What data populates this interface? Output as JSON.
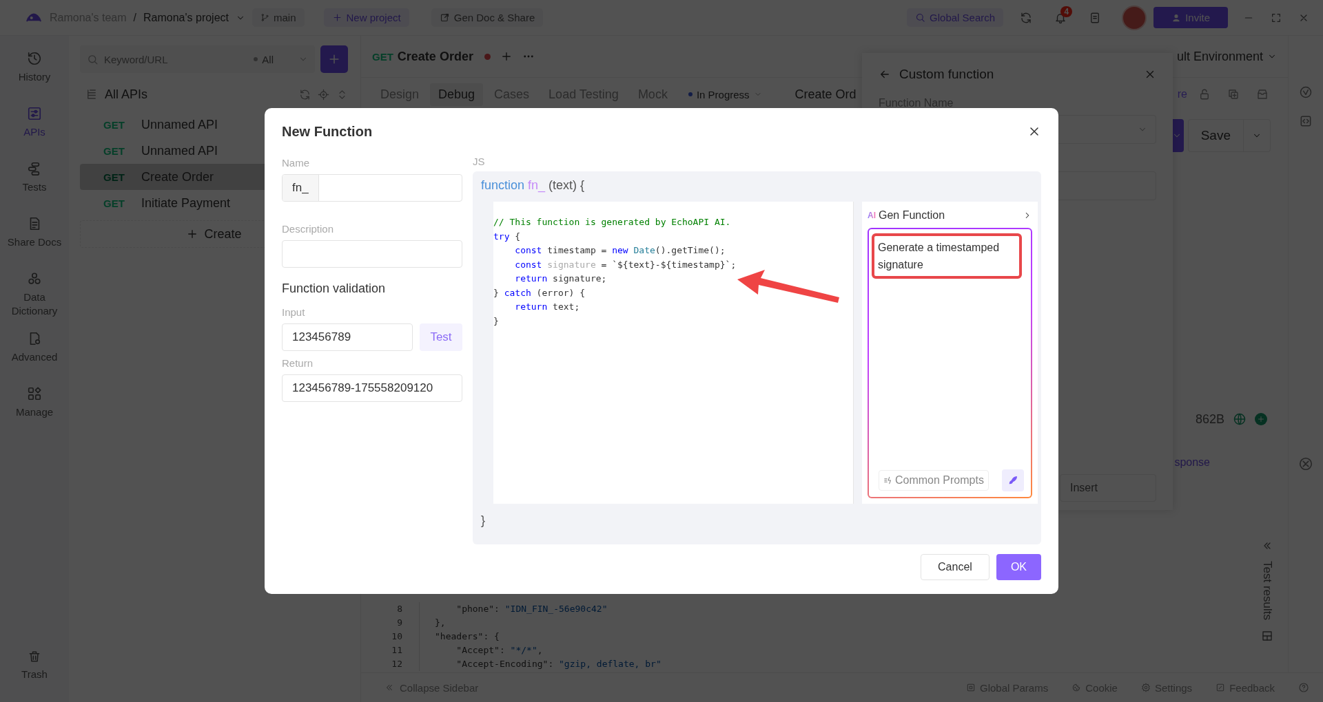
{
  "top_bar": {
    "team": "Ramona's team",
    "separator": "/",
    "project": "Ramona's project",
    "branch": "main",
    "new_project": "New project",
    "gen_doc": "Gen Doc & Share",
    "global_search": "Global Search",
    "notification_count": "4",
    "invite": "Invite"
  },
  "nav": [
    {
      "label": "History",
      "selected": false
    },
    {
      "label": "APIs",
      "selected": true
    },
    {
      "label": "Tests",
      "selected": false
    },
    {
      "label": "Share Docs",
      "selected": false
    },
    {
      "label": "Data Dictionary",
      "selected": false
    },
    {
      "label": "Advanced",
      "selected": false
    },
    {
      "label": "Manage",
      "selected": false
    }
  ],
  "nav_bottom": {
    "label": "Trash"
  },
  "api_panel": {
    "search_placeholder": "Keyword/URL",
    "filter": "All",
    "tree_title": "All APIs",
    "items": [
      {
        "method": "GET",
        "name": "Unnamed API",
        "selected": false
      },
      {
        "method": "GET",
        "name": "Unnamed API",
        "selected": false
      },
      {
        "method": "GET",
        "name": "Create Order",
        "selected": true
      },
      {
        "method": "GET",
        "name": "Initiate Payment",
        "selected": false
      }
    ],
    "create": "Create"
  },
  "request_tab": {
    "method": "GET",
    "name": "Create Order",
    "modified": true
  },
  "environment": "ult Environment",
  "subtabs": [
    {
      "label": "Design",
      "selected": false
    },
    {
      "label": "Debug",
      "selected": true
    },
    {
      "label": "Cases",
      "selected": false
    },
    {
      "label": "Load Testing",
      "selected": false
    },
    {
      "label": "Mock",
      "selected": false
    }
  ],
  "status": "In Progress",
  "request_title": "Create Ord",
  "link_fragment": "re",
  "save": "Save",
  "response": {
    "size": "862B",
    "tab": "sponse"
  },
  "code_preview": [
    {
      "line": "8",
      "tokens": [
        {
          "text": "    \"phone\"",
          "kind": "key"
        },
        {
          "text": ": ",
          "kind": "plain"
        },
        {
          "text": "\"IDN_FIN_-56e90c42\"",
          "kind": "string"
        }
      ]
    },
    {
      "line": "9",
      "tokens": [
        {
          "text": "},",
          "kind": "plain"
        }
      ]
    },
    {
      "line": "10",
      "tokens": [
        {
          "text": "\"headers\"",
          "kind": "key"
        },
        {
          "text": ": {",
          "kind": "plain"
        }
      ]
    },
    {
      "line": "11",
      "tokens": [
        {
          "text": "    \"Accept\"",
          "kind": "key"
        },
        {
          "text": ": ",
          "kind": "plain"
        },
        {
          "text": "\"*/*\"",
          "kind": "string"
        },
        {
          "text": ",",
          "kind": "plain"
        }
      ]
    },
    {
      "line": "12",
      "tokens": [
        {
          "text": "    \"Accept-Encoding\"",
          "kind": "key"
        },
        {
          "text": ": ",
          "kind": "plain"
        },
        {
          "text": "\"gzip, deflate, br\"",
          "kind": "string"
        }
      ]
    }
  ],
  "test_results": "Test results",
  "footer": {
    "collapse": "Collapse Sidebar",
    "items": [
      "Global Params",
      "Cookie",
      "Settings",
      "Feedback"
    ]
  },
  "drawer": {
    "title": "Custom function",
    "field_label": "Function Name",
    "insert": "Insert"
  },
  "modal": {
    "title": "New Function",
    "name_label": "Name",
    "name_prefix": "fn_",
    "description_label": "Description",
    "validation_title": "Function validation",
    "input_label": "Input",
    "input_value": "123456789",
    "test_button": "Test",
    "return_label": "Return",
    "return_value": "123456789-175558209120",
    "lang_label": "JS",
    "signature": {
      "keyword": "function",
      "name": "fn_",
      "params": "(text) {"
    },
    "code": [
      {
        "tokens": [
          {
            "text": "// This function is generated by EchoAPI AI.",
            "kind": "comment"
          }
        ]
      },
      {
        "tokens": [
          {
            "text": "try",
            "kind": "keyword"
          },
          {
            "text": " {",
            "kind": "plain"
          }
        ]
      },
      {
        "tokens": [
          {
            "text": "    const",
            "kind": "keyword"
          },
          {
            "text": " timestamp = ",
            "kind": "plain"
          },
          {
            "text": "new ",
            "kind": "keyword"
          },
          {
            "text": "Date",
            "kind": "type"
          },
          {
            "text": "().getTime();",
            "kind": "plain"
          }
        ]
      },
      {
        "tokens": [
          {
            "text": "    const ",
            "kind": "keyword"
          },
          {
            "text": "signature",
            "kind": "muted"
          },
          {
            "text": " = `${text}-${timestamp}`;",
            "kind": "plain"
          }
        ]
      },
      {
        "tokens": [
          {
            "text": "    return",
            "kind": "keyword"
          },
          {
            "text": " signature;",
            "kind": "plain"
          }
        ]
      },
      {
        "tokens": [
          {
            "text": "} ",
            "kind": "plain"
          },
          {
            "text": "catch",
            "kind": "keyword"
          },
          {
            "text": " (error) {",
            "kind": "plain"
          }
        ]
      },
      {
        "tokens": [
          {
            "text": "    return",
            "kind": "keyword"
          },
          {
            "text": " text;",
            "kind": "plain"
          }
        ]
      },
      {
        "tokens": [
          {
            "text": "}",
            "kind": "plain"
          }
        ]
      }
    ],
    "closing": "}",
    "ai": {
      "badge": "AI",
      "title": "Gen Function",
      "prompt": "Generate a timestamped signature",
      "common_prompts": "Common Prompts"
    },
    "cancel": "Cancel",
    "ok": "OK"
  }
}
